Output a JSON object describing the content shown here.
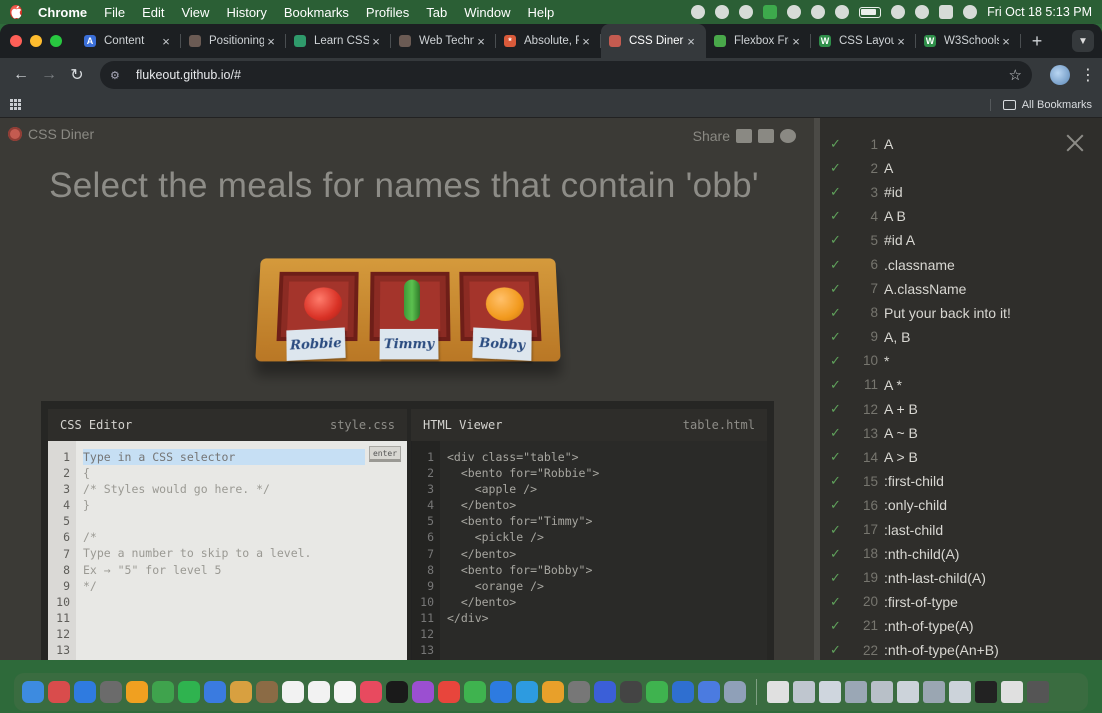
{
  "menubar": {
    "app": "Chrome",
    "items": [
      "File",
      "Edit",
      "View",
      "History",
      "Bookmarks",
      "Profiles",
      "Tab",
      "Window",
      "Help"
    ],
    "datetime": "Fri Oct 18  5:13 PM"
  },
  "tabs": [
    {
      "title": "Content",
      "icon": "A",
      "color": "#3b6fd8"
    },
    {
      "title": "Positioning",
      "icon": "",
      "color": "#6b5b54"
    },
    {
      "title": "Learn CSS",
      "icon": "",
      "color": "#2f9a6b"
    },
    {
      "title": "Web Techno",
      "icon": "",
      "color": "#6b5b54"
    },
    {
      "title": "Absolute, R",
      "icon": "*",
      "color": "#d95a3a"
    },
    {
      "title": "CSS Diner",
      "icon": "",
      "color": "#c45b50",
      "active": true
    },
    {
      "title": "Flexbox Fro",
      "icon": "",
      "color": "#49a84a"
    },
    {
      "title": "CSS Layout",
      "icon": "W",
      "color": "#2f8f4a"
    },
    {
      "title": "W3Schools",
      "icon": "W",
      "color": "#2f8f4a"
    }
  ],
  "address": {
    "url": "flukeout.github.io/#"
  },
  "bookmarks": {
    "all": "All Bookmarks"
  },
  "game": {
    "logo": "CSS Diner",
    "share": "Share",
    "headline": "Select the meals for names that contain 'obb'",
    "names": [
      "Robbie",
      "Timmy",
      "Bobby"
    ]
  },
  "css_editor": {
    "title": "CSS Editor",
    "file": "style.css",
    "placeholder": "Type in a CSS selector",
    "enter": "enter",
    "line_numbers": [
      "1",
      "2",
      "3",
      "4",
      "5",
      "6",
      "7",
      "8",
      "9",
      "10",
      "11",
      "12",
      "13"
    ],
    "lines": [
      "{",
      "/* Styles would go here. */",
      "}",
      "",
      "/*",
      "Type a number to skip to a level.",
      "Ex → \"5\" for level 5",
      "*/",
      "",
      "",
      "",
      ""
    ]
  },
  "html_viewer": {
    "title": "HTML Viewer",
    "file": "table.html",
    "line_numbers": [
      "1",
      "2",
      "3",
      "4",
      "5",
      "6",
      "7",
      "8",
      "9",
      "10",
      "11",
      "12",
      "13"
    ],
    "lines": [
      "<div class=\"table\">",
      "  <bento for=\"Robbie\">",
      "    <apple />",
      "  </bento>",
      "  <bento for=\"Timmy\">",
      "    <pickle />",
      "  </bento>",
      "  <bento for=\"Bobby\">",
      "    <orange />",
      "  </bento>",
      "</div>",
      "",
      ""
    ]
  },
  "levels": [
    {
      "num": "1",
      "name": "A"
    },
    {
      "num": "2",
      "name": "A"
    },
    {
      "num": "3",
      "name": "#id"
    },
    {
      "num": "4",
      "name": "A  B"
    },
    {
      "num": "5",
      "name": "#id  A"
    },
    {
      "num": "6",
      "name": ".classname"
    },
    {
      "num": "7",
      "name": "A.className"
    },
    {
      "num": "8",
      "name": "Put your back into it!"
    },
    {
      "num": "9",
      "name": "A, B"
    },
    {
      "num": "10",
      "name": "*"
    },
    {
      "num": "11",
      "name": "A  *"
    },
    {
      "num": "12",
      "name": "A + B"
    },
    {
      "num": "13",
      "name": "A ~ B"
    },
    {
      "num": "14",
      "name": "A > B"
    },
    {
      "num": "15",
      "name": ":first-child"
    },
    {
      "num": "16",
      "name": ":only-child"
    },
    {
      "num": "17",
      "name": ":last-child"
    },
    {
      "num": "18",
      "name": ":nth-child(A)"
    },
    {
      "num": "19",
      "name": ":nth-last-child(A)"
    },
    {
      "num": "20",
      "name": ":first-of-type"
    },
    {
      "num": "21",
      "name": ":nth-of-type(A)"
    },
    {
      "num": "22",
      "name": ":nth-of-type(An+B)"
    }
  ],
  "dock": {
    "colors": [
      "#3d8be0",
      "#d94c4c",
      "#2f7be0",
      "#6b6b6b",
      "#f0a020",
      "#3fa34d",
      "#2fb34f",
      "#3a7be0",
      "#d8a040",
      "#8b6b45",
      "#f2f2f2",
      "#f2f2f2",
      "#f5f5f5",
      "#e84a5f",
      "#1a1a1a",
      "#9b4fd1",
      "#e8453c",
      "#3fb34f",
      "#2d7be0",
      "#2d9be0",
      "#e8a02a",
      "#777",
      "#3b5fd8",
      "#444",
      "#3fb34f",
      "#2f6fd0",
      "#4b7be0",
      "#8fa0b8"
    ],
    "recent_colors": [
      "#e0e0e0",
      "#bfc6cf",
      "#cfd6de",
      "#9aa7b5",
      "#b8c0c8",
      "#ccd3da",
      "#9aa6b2",
      "#ccd3da",
      "#222",
      "#e0e0e0",
      "#555"
    ]
  }
}
